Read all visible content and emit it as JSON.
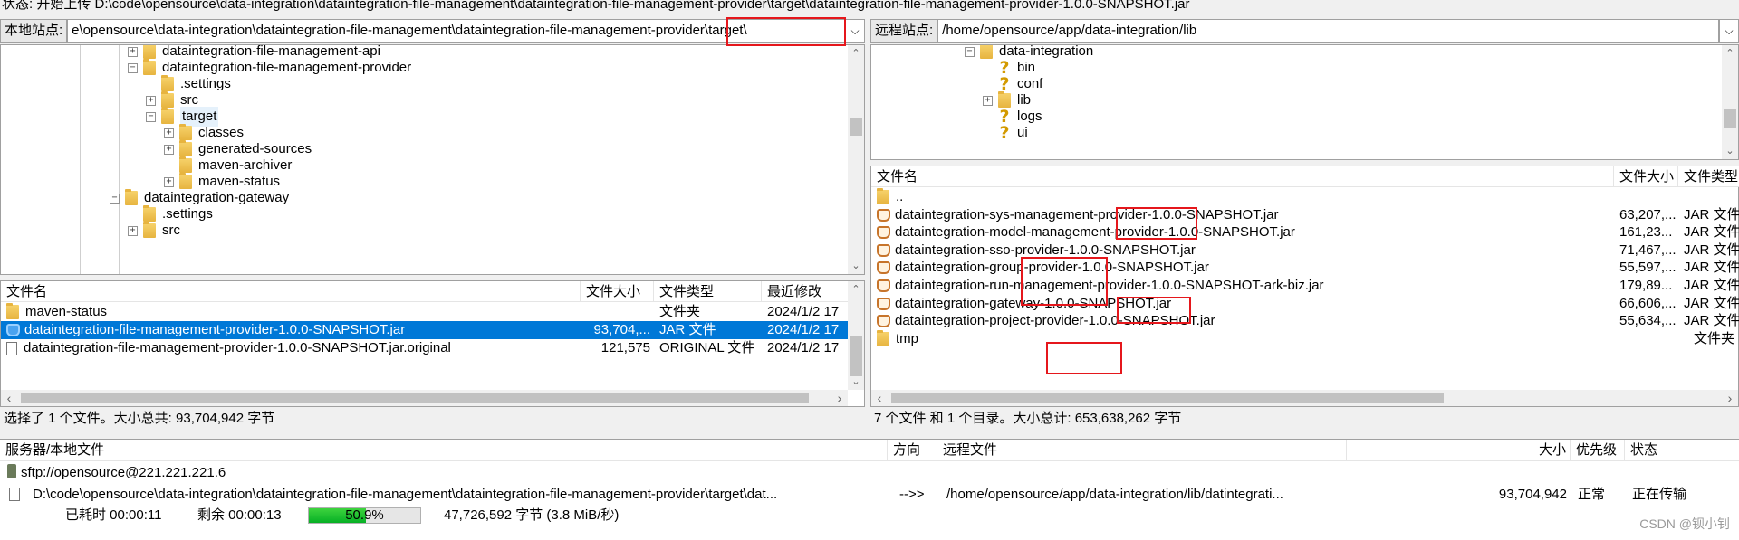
{
  "status_line": "状态: 开始上传 D:\\code\\opensource\\data-integration\\dataintegration-file-management\\dataintegration-file-management-provider\\target\\dataintegration-file-management-provider-1.0.0-SNAPSHOT.jar",
  "local": {
    "site_label": "本地站点:",
    "site_path": "e\\opensource\\data-integration\\dataintegration-file-management\\dataintegration-file-management-provider\\target\\",
    "tree": [
      {
        "label": "dataintegration-file-management-api",
        "expander": "+",
        "icon": "folder"
      },
      {
        "label": "dataintegration-file-management-provider",
        "expander": "-",
        "icon": "folder"
      },
      {
        "label": ".settings",
        "expander": "",
        "icon": "folder"
      },
      {
        "label": "src",
        "expander": "+",
        "icon": "folder"
      },
      {
        "label": "target",
        "expander": "-",
        "icon": "folder"
      },
      {
        "label": "classes",
        "expander": "+",
        "icon": "folder"
      },
      {
        "label": "generated-sources",
        "expander": "+",
        "icon": "folder"
      },
      {
        "label": "maven-archiver",
        "expander": "",
        "icon": "folder"
      },
      {
        "label": "maven-status",
        "expander": "+",
        "icon": "folder"
      },
      {
        "label": "dataintegration-gateway",
        "expander": "-",
        "icon": "folder"
      },
      {
        "label": ".settings",
        "expander": "",
        "icon": "folder"
      },
      {
        "label": "src",
        "expander": "+",
        "icon": "folder"
      }
    ],
    "columns": [
      "文件名",
      "文件大小",
      "文件类型",
      "最近修改"
    ],
    "files": [
      {
        "name": "maven-status",
        "size": "",
        "type": "文件夹",
        "modified": "2024/1/2 17",
        "icon": "folder"
      },
      {
        "name": "dataintegration-file-management-provider-1.0.0-SNAPSHOT.jar",
        "size": "93,704,...",
        "type": "JAR 文件",
        "modified": "2024/1/2 17",
        "icon": "jar"
      },
      {
        "name": "dataintegration-file-management-provider-1.0.0-SNAPSHOT.jar.original",
        "size": "121,575",
        "type": "ORIGINAL 文件",
        "modified": "2024/1/2 17",
        "icon": "doc"
      }
    ],
    "summary": "选择了 1 个文件。大小总共: 93,704,942 字节"
  },
  "remote": {
    "site_label": "远程站点:",
    "site_path": "/home/opensource/app/data-integration/lib",
    "tree": [
      {
        "label": "data-integration",
        "expander": "-",
        "icon": "folder"
      },
      {
        "label": "bin",
        "expander": "",
        "icon": "question"
      },
      {
        "label": "conf",
        "expander": "",
        "icon": "question"
      },
      {
        "label": "lib",
        "expander": "+",
        "icon": "folder"
      },
      {
        "label": "logs",
        "expander": "",
        "icon": "question"
      },
      {
        "label": "ui",
        "expander": "",
        "icon": "question"
      }
    ],
    "columns": [
      "文件名",
      "文件大小",
      "文件类型"
    ],
    "files": [
      {
        "name": "..",
        "size": "",
        "type": "",
        "icon": "folder"
      },
      {
        "name": "dataintegration-sys-management-provider-1.0.0-SNAPSHOT.jar",
        "size": "63,207,...",
        "type": "JAR 文件",
        "icon": "jar"
      },
      {
        "name": "dataintegration-model-management-provider-1.0.0-SNAPSHOT.jar",
        "size": "161,23...",
        "type": "JAR 文件",
        "icon": "jar"
      },
      {
        "name": "dataintegration-sso-provider-1.0.0-SNAPSHOT.jar",
        "size": "71,467,...",
        "type": "JAR 文件",
        "icon": "jar"
      },
      {
        "name": "dataintegration-group-provider-1.0.0-SNAPSHOT.jar",
        "size": "55,597,...",
        "type": "JAR 文件",
        "icon": "jar"
      },
      {
        "name": "dataintegration-run-management-provider-1.0.0-SNAPSHOT-ark-biz.jar",
        "size": "179,89...",
        "type": "JAR 文件",
        "icon": "jar"
      },
      {
        "name": "dataintegration-gateway-1.0.0-SNAPSHOT.jar",
        "size": "66,606,...",
        "type": "JAR 文件",
        "icon": "jar"
      },
      {
        "name": "dataintegration-project-provider-1.0.0-SNAPSHOT.jar",
        "size": "55,634,...",
        "type": "JAR 文件",
        "icon": "jar"
      },
      {
        "name": "tmp",
        "size": "",
        "type": "文件夹",
        "icon": "folder"
      }
    ],
    "summary": "7 个文件 和 1 个目录。大小总计: 653,638,262 字节"
  },
  "queue": {
    "columns": [
      "服务器/本地文件",
      "方向",
      "远程文件",
      "大小",
      "优先级",
      "状态"
    ],
    "server": "sftp://opensource@221.221.221.6",
    "local_file": "D:\\code\\opensource\\data-integration\\dataintegration-file-management\\dataintegration-file-management-provider\\target\\dat...",
    "direction": "-->>",
    "remote_file": "/home/opensource/app/data-integration/lib/datintegrati...",
    "size": "93,704,942",
    "priority": "正常",
    "status": "正在传输",
    "elapsed": "已耗时 00:00:11",
    "remaining": "剩余 00:00:13",
    "progress_text": "50.9%",
    "progress_value": 0.509,
    "transferred": "47,726,592 字节 (3.8 MiB/秒)"
  },
  "watermark": "CSDN @钡小钊"
}
